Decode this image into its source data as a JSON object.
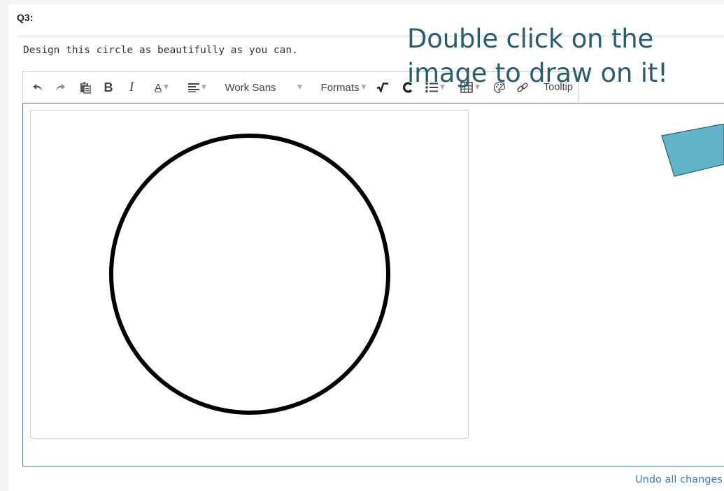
{
  "question": {
    "number": "Q3:",
    "prompt": "Design this circle as beautifully as you can."
  },
  "toolbar": {
    "icons": [
      "undo-icon",
      "redo-icon",
      "paste-icon",
      "bold-icon",
      "italic-icon",
      "font-color-icon",
      "align-icon",
      "math-icon",
      "chem-icon",
      "list-icon",
      "table-icon",
      "palette-icon",
      "link-icon"
    ],
    "bold_label": "B",
    "italic_label": "I",
    "font_color_label": "A",
    "font_family": "Work Sans",
    "formats_label": "Formats",
    "tooltip_label": "Tooltip"
  },
  "canvas": {
    "hint": "Double click on the image to draw on it!",
    "colors": {
      "hint_text": "#2c5d6c",
      "arrow_fill": "#62b4c9",
      "circle_stroke": "#000000"
    }
  },
  "footer": {
    "undo_label": "Undo all changes"
  }
}
